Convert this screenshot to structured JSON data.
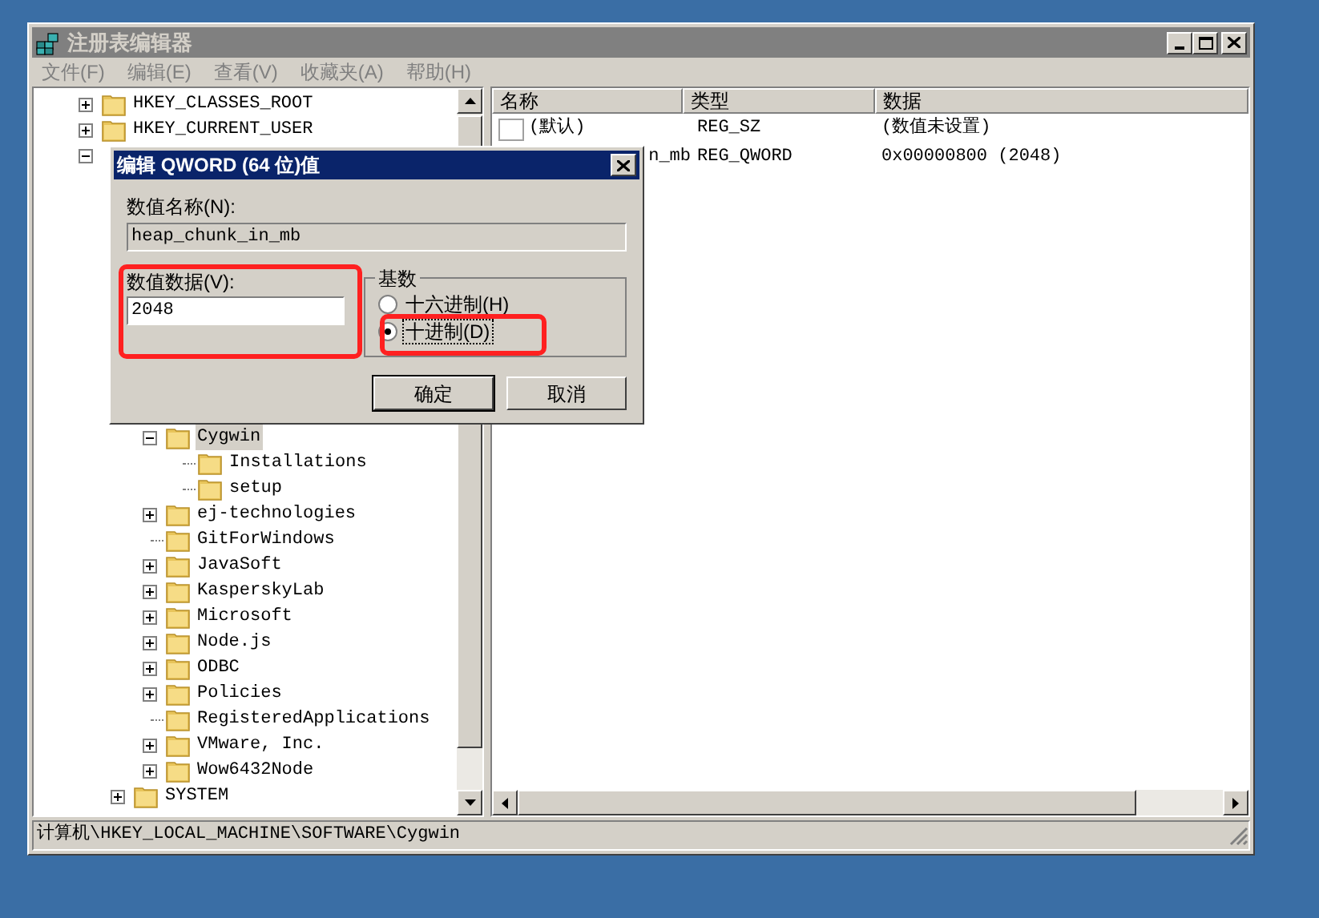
{
  "window": {
    "title": "注册表编辑器",
    "active": false
  },
  "menu": [
    "文件(F)",
    "编辑(E)",
    "查看(V)",
    "收藏夹(A)",
    "帮助(H)"
  ],
  "tree": [
    {
      "label": "HKEY_CLASSES_ROOT",
      "expanded": false
    },
    {
      "label": "HKEY_CURRENT_USER",
      "expanded": false
    },
    {
      "expanded": true,
      "children": [
        {
          "children": [
            {
              "label": "Cygwin",
              "expanded": true,
              "selected": true,
              "children": [
                {
                  "label": "Installations",
                  "selected": false
                },
                {
                  "label": "setup",
                  "selected": false
                }
              ]
            },
            {
              "label": "ej-technologies",
              "expanded": false,
              "selected": false
            },
            {
              "label": "GitForWindows",
              "selected": false
            },
            {
              "label": "JavaSoft",
              "expanded": false,
              "selected": false
            },
            {
              "label": "KasperskyLab",
              "expanded": false,
              "selected": false
            },
            {
              "label": "Microsoft",
              "expanded": false,
              "selected": false
            },
            {
              "label": "Node.js",
              "expanded": false,
              "selected": false
            },
            {
              "label": "ODBC",
              "expanded": false,
              "selected": false
            },
            {
              "label": "Policies",
              "expanded": false,
              "selected": false
            },
            {
              "label": "RegisteredApplications",
              "selected": false
            },
            {
              "label": "VMware, Inc.",
              "expanded": false,
              "selected": false
            },
            {
              "label": "Wow6432Node",
              "expanded": false,
              "selected": false
            }
          ]
        },
        {
          "label": "SYSTEM",
          "expanded": false,
          "selected": false
        }
      ]
    }
  ],
  "list": {
    "columns": [
      "名称",
      "类型",
      "数据"
    ],
    "rows": [
      {
        "kind": "string",
        "name": "(默认)",
        "type": "REG_SZ",
        "data": "(数值未设置)"
      },
      {
        "name": "n_mb",
        "type": "REG_QWORD",
        "data": "0x00000800 (2048)"
      }
    ]
  },
  "status_bar": "计算机\\HKEY_LOCAL_MACHINE\\SOFTWARE\\Cygwin",
  "dialog": {
    "title": "编辑 QWORD (64 位)值",
    "name_label": "数值名称(N):",
    "name_value": "heap_chunk_in_mb",
    "data_label": "数值数据(V):",
    "data_value": "2048",
    "base_label": "基数",
    "radios": [
      {
        "label": "十六进制(H)",
        "selected": false
      },
      {
        "label": "十进制(D)",
        "selected": true
      }
    ],
    "buttons": [
      {
        "label": "确定",
        "default": true
      },
      {
        "label": "取消",
        "default": false
      }
    ]
  }
}
